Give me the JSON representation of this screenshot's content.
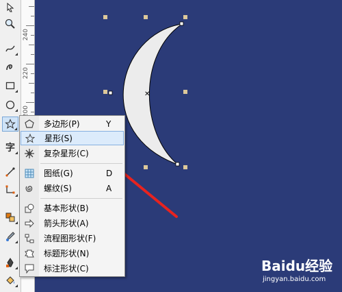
{
  "ruler": {
    "labels": [
      "240",
      "220",
      "200"
    ]
  },
  "menu": {
    "items": [
      {
        "label": "多边形(P)",
        "shortcut": "Y",
        "icon": "polygon-icon"
      },
      {
        "label": "星形(S)",
        "shortcut": "",
        "icon": "star-icon"
      },
      {
        "label": "复杂星形(C)",
        "shortcut": "",
        "icon": "complex-star-icon"
      },
      {
        "label": "图纸(G)",
        "shortcut": "D",
        "icon": "graph-paper-icon"
      },
      {
        "label": "螺纹(S)",
        "shortcut": "A",
        "icon": "spiral-icon"
      },
      {
        "label": "基本形状(B)",
        "shortcut": "",
        "icon": "basic-shapes-icon"
      },
      {
        "label": "箭头形状(A)",
        "shortcut": "",
        "icon": "arrow-shapes-icon"
      },
      {
        "label": "流程图形状(F)",
        "shortcut": "",
        "icon": "flowchart-shapes-icon"
      },
      {
        "label": "标题形状(N)",
        "shortcut": "",
        "icon": "banner-shapes-icon"
      },
      {
        "label": "标注形状(C)",
        "shortcut": "",
        "icon": "callout-shapes-icon"
      }
    ]
  },
  "watermark": {
    "brand": "Baidu经验",
    "url": "jingyan.baidu.com"
  },
  "colors": {
    "canvas": "#2b3b78",
    "moon": "#ececec",
    "arrow": "#e8231f",
    "handle": "#dcc89a",
    "highlight": "#dcebfb"
  }
}
